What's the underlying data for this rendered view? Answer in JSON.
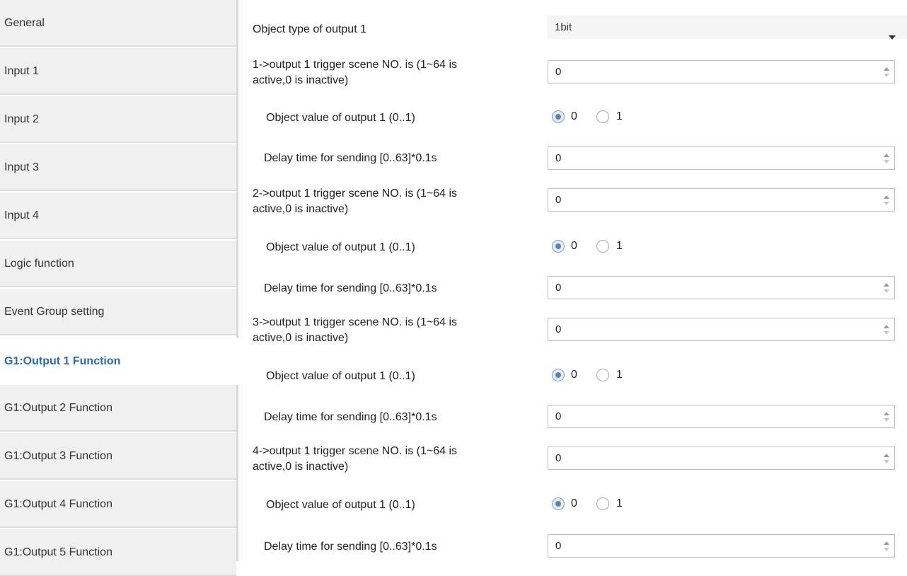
{
  "sidebar": {
    "items": [
      {
        "label": "General"
      },
      {
        "label": "Input 1"
      },
      {
        "label": "Input 2"
      },
      {
        "label": "Input 3"
      },
      {
        "label": "Input 4"
      },
      {
        "label": "Logic function"
      },
      {
        "label": "Event Group setting"
      },
      {
        "label": "G1:Output 1 Function",
        "active": true
      },
      {
        "label": "G1:Output 2 Function"
      },
      {
        "label": "G1:Output 3 Function"
      },
      {
        "label": "G1:Output 4 Function"
      },
      {
        "label": "G1:Output 5 Function"
      }
    ]
  },
  "main": {
    "object_type": {
      "label": "Object type of output 1",
      "value": "1bit"
    },
    "groups": [
      {
        "trigger_label_line1": "1->output 1 trigger scene NO. is (1~64 is",
        "trigger_label_line2": "active,0 is inactive)",
        "trigger_value": "0",
        "object_value_label": "Object value of output 1 (0..1)",
        "radio_options": [
          "0",
          "1"
        ],
        "radio_selected": "0",
        "delay_label": "Delay time for sending [0..63]*0.1s",
        "delay_value": "0"
      },
      {
        "trigger_label_line1": "2->output 1 trigger scene NO. is (1~64 is",
        "trigger_label_line2": "active,0 is inactive)",
        "trigger_value": "0",
        "object_value_label": "Object value of output 1 (0..1)",
        "radio_options": [
          "0",
          "1"
        ],
        "radio_selected": "0",
        "delay_label": "Delay time for sending [0..63]*0.1s",
        "delay_value": "0"
      },
      {
        "trigger_label_line1": "3->output 1 trigger scene NO. is (1~64 is",
        "trigger_label_line2": "active,0 is inactive)",
        "trigger_value": "0",
        "object_value_label": "Object value of output 1 (0..1)",
        "radio_options": [
          "0",
          "1"
        ],
        "radio_selected": "0",
        "delay_label": "Delay time for sending [0..63]*0.1s",
        "delay_value": "0"
      },
      {
        "trigger_label_line1": "4->output 1 trigger scene NO. is (1~64 is",
        "trigger_label_line2": "active,0 is inactive)",
        "trigger_value": "0",
        "object_value_label": "Object value of output 1 (0..1)",
        "radio_options": [
          "0",
          "1"
        ],
        "radio_selected": "0",
        "delay_label": "Delay time for sending [0..63]*0.1s",
        "delay_value": "0"
      }
    ]
  },
  "colors": {
    "sidebar_bg": "#f0f0f0",
    "active_text": "#2a6ab0",
    "radio_selected": "#5b82b8"
  },
  "icons": {
    "dropdown": "chevron-down-icon",
    "spinner": "spinner-arrows-icon"
  }
}
